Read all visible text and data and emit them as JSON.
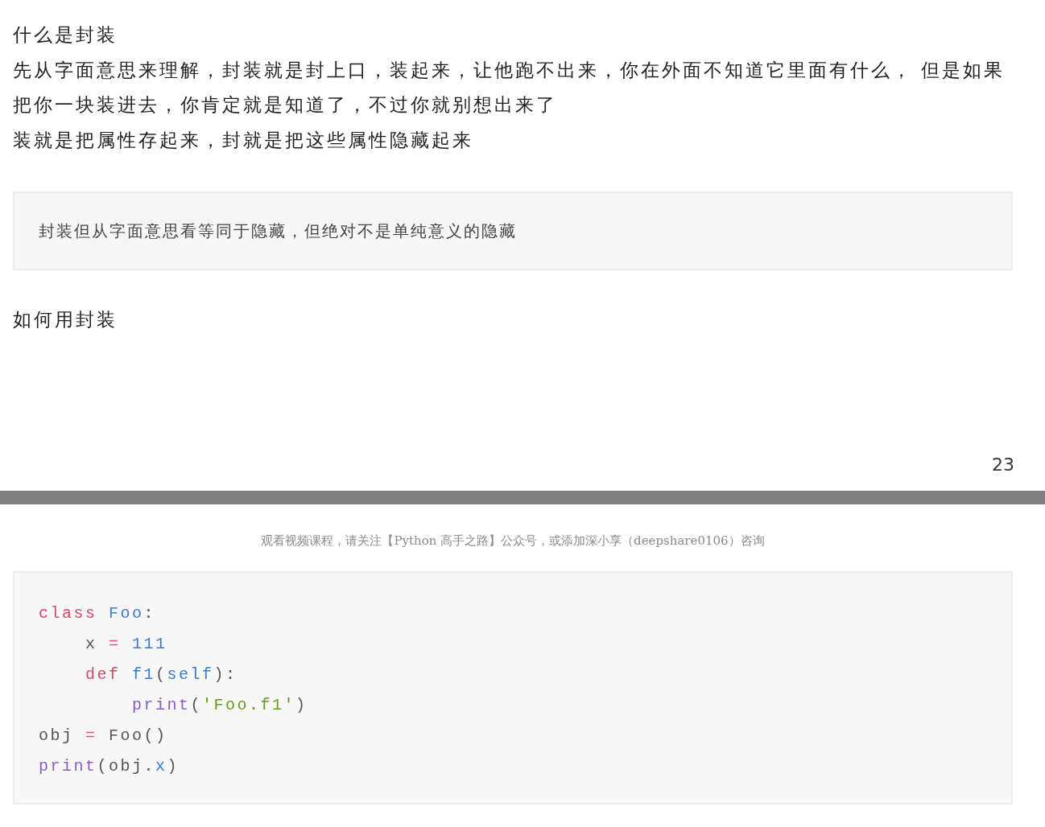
{
  "pages": [
    {
      "blocks": [
        {
          "kind": "paragraph",
          "text": "什么是封装"
        },
        {
          "kind": "paragraph",
          "text": "先从字面意思来理解，封装就是封上口，装起来，让他跑不出来，你在外面不知道它里面有什么，  但是如果把你一块装进去，你肯定就是知道了，不过你就别想出来了"
        },
        {
          "kind": "paragraph",
          "text": "装就是把属性存起来，封就是把这些属性隐藏起来"
        },
        {
          "kind": "quote",
          "text": "封装但从字面意思看等同于隐藏，但绝对不是单纯意义的隐藏"
        },
        {
          "kind": "heading",
          "text": "如何用封装"
        }
      ],
      "page_number": "23"
    },
    {
      "header": "观看视频课程，请关注【Python 高手之路】公众号，或添加深小享（deepshare0106）咨询",
      "blocks": [
        {
          "kind": "code",
          "lines": [
            {
              "tokens": [
                {
                  "kind": "keyword",
                  "text": "class "
                },
                {
                  "kind": "title",
                  "text": "Foo"
                },
                {
                  "kind": "plain",
                  "text": ":"
                }
              ]
            },
            {
              "tokens": [
                {
                  "kind": "plain",
                  "text": "    x "
                },
                {
                  "kind": "operator",
                  "text": "="
                },
                {
                  "kind": "number",
                  "text": " 111"
                }
              ]
            },
            {
              "tokens": [
                {
                  "kind": "keyword",
                  "text": "    def "
                },
                {
                  "kind": "title",
                  "text": "f1"
                },
                {
                  "kind": "plain",
                  "text": "("
                },
                {
                  "kind": "param",
                  "text": "self"
                },
                {
                  "kind": "plain",
                  "text": "):"
                }
              ]
            },
            {
              "tokens": [
                {
                  "kind": "builtin",
                  "text": "        print"
                },
                {
                  "kind": "plain",
                  "text": "("
                },
                {
                  "kind": "string",
                  "text": "'Foo.f1'"
                },
                {
                  "kind": "plain",
                  "text": ")"
                }
              ]
            },
            {
              "tokens": [
                {
                  "kind": "plain",
                  "text": "obj "
                },
                {
                  "kind": "operator",
                  "text": "="
                },
                {
                  "kind": "plain",
                  "text": " Foo()"
                }
              ]
            },
            {
              "tokens": [
                {
                  "kind": "builtin",
                  "text": "print"
                },
                {
                  "kind": "plain",
                  "text": "(obj."
                },
                {
                  "kind": "param",
                  "text": "x"
                },
                {
                  "kind": "plain",
                  "text": ")"
                }
              ]
            }
          ]
        }
      ]
    }
  ]
}
